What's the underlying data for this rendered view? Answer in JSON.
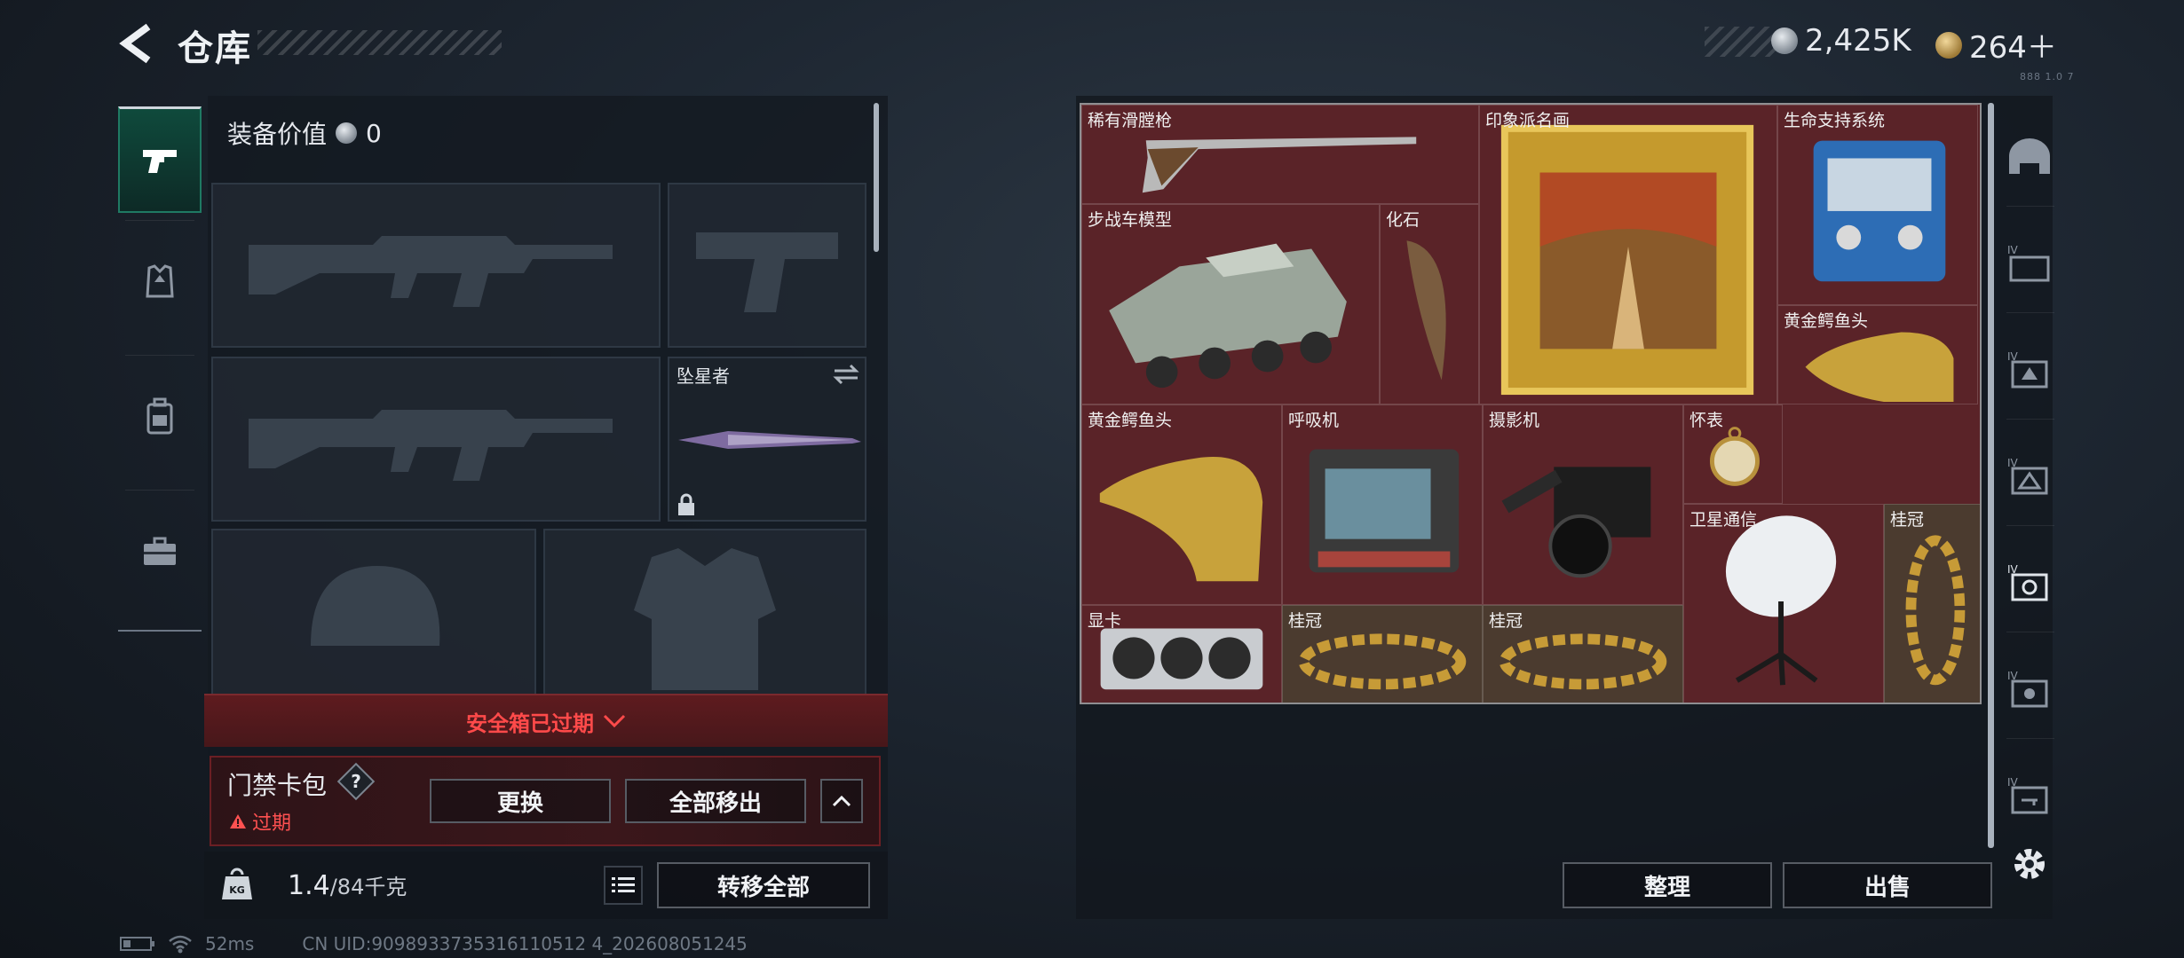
{
  "header": {
    "title": "仓库",
    "back_icon": "back-arrow-icon"
  },
  "currency": [
    {
      "icon": "silver-coin-icon",
      "value": "2,425K",
      "color": "#9aa3ad"
    },
    {
      "icon": "gold-coin-icon",
      "value": "264＋",
      "color": "#c9a25a"
    }
  ],
  "version": "888 1.0 7",
  "left_tabs": [
    {
      "name": "weapons",
      "icon": "pistol-icon",
      "active": true
    },
    {
      "name": "armor",
      "icon": "vest-icon"
    },
    {
      "name": "backpack",
      "icon": "backpack-icon"
    },
    {
      "name": "case",
      "icon": "briefcase-icon"
    }
  ],
  "equipment": {
    "value_label": "装备价值",
    "value": "0",
    "melee_name": "坠星者"
  },
  "safe_box": {
    "banner": "安全箱已过期"
  },
  "keycard": {
    "title": "门禁卡包",
    "help": "?",
    "expired": "过期",
    "change_label": "更换",
    "remove_all_label": "全部移出"
  },
  "weight": {
    "current": "1.4",
    "max": "/84千克",
    "unit_icon": "KG",
    "transfer_all_label": "转移全部"
  },
  "stash": {
    "items": [
      {
        "label": "稀有滑膛枪",
        "icon": "musket-icon"
      },
      {
        "label": "印象派名画",
        "icon": "painting-icon"
      },
      {
        "label": "生命支持系统",
        "icon": "life-support-icon"
      },
      {
        "label": "步战车模型",
        "icon": "ifv-model-icon"
      },
      {
        "label": "化石",
        "icon": "fossil-icon"
      },
      {
        "label": "黄金鳄鱼头",
        "icon": "gold-croc-head-icon"
      },
      {
        "label": "黄金鳄鱼头",
        "icon": "gold-croc-head-icon"
      },
      {
        "label": "呼吸机",
        "icon": "ventilator-icon"
      },
      {
        "label": "摄影机",
        "icon": "camera-icon"
      },
      {
        "label": "怀表",
        "icon": "pocket-watch-icon"
      },
      {
        "label": "卫星通信",
        "icon": "satellite-dish-icon"
      },
      {
        "label": "桂冠",
        "icon": "laurel-icon"
      },
      {
        "label": "显卡",
        "icon": "gpu-icon"
      },
      {
        "label": "桂冠",
        "icon": "laurel-icon"
      },
      {
        "label": "桂冠",
        "icon": "laurel-icon"
      }
    ],
    "sort_label": "整理",
    "sell_label": "出售"
  },
  "right_tabs": [
    "helmet-icon",
    "tier4-box-icon",
    "tier4-case-icon",
    "tier4-armor-icon",
    "tier4-safe-icon",
    "tier4-vault-icon",
    "tier4-key-icon"
  ],
  "settings_icon": "gear-icon",
  "status": {
    "ping": "52ms",
    "uid": "CN UID:9098933735316110512 4_202608051245"
  }
}
